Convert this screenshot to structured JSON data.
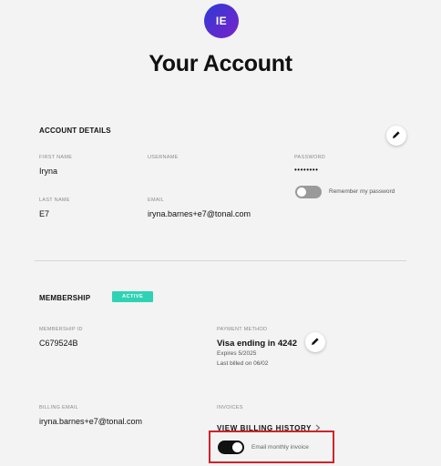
{
  "header": {
    "avatar_initials": "IE",
    "title": "Your Account"
  },
  "account_details": {
    "section_title": "ACCOUNT DETAILS",
    "first_name_label": "FIRST NAME",
    "first_name": "Iryna",
    "username_label": "USERNAME",
    "username": "",
    "password_label": "PASSWORD",
    "password": "••••••••",
    "remember_password_label": "Remember my password",
    "remember_password_on": false,
    "last_name_label": "LAST NAME",
    "last_name": "E7",
    "email_label": "EMAIL",
    "email": "iryna.barnes+e7@tonal.com"
  },
  "membership": {
    "section_title": "MEMBERSHIP",
    "status_badge": "ACTIVE",
    "membership_id_label": "MEMBERSHIP ID",
    "membership_id": "C679524B",
    "payment_method_label": "PAYMENT METHOD",
    "payment_method": "Visa ending in 4242",
    "expires": "Expires 5/2025",
    "last_billed": "Last billed on 06/02",
    "billing_email_label": "BILLING EMAIL",
    "billing_email": "iryna.barnes+e7@tonal.com",
    "invoices_label": "INVOICES",
    "view_billing_history": "VIEW BILLING HISTORY",
    "email_invoice_label": "Email monthly invoice",
    "email_invoice_on": true
  },
  "colors": {
    "badge": "#2ed3b5",
    "highlight": "#d3222a",
    "avatar_start": "#2c3bd6",
    "avatar_end": "#7b22c9"
  },
  "icons": [
    "pencil-icon",
    "chevron-right-icon"
  ]
}
